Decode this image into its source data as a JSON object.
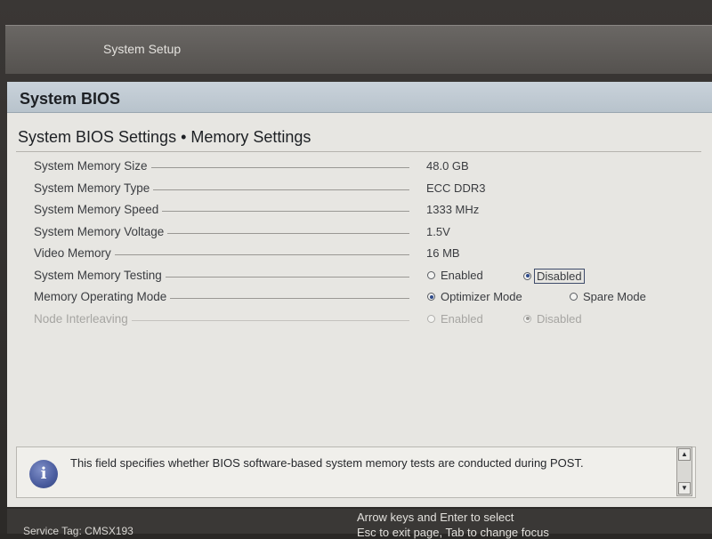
{
  "window": {
    "title": "System Setup"
  },
  "section": {
    "title": "System BIOS"
  },
  "subheader": "System BIOS Settings • Memory Settings",
  "settings": [
    {
      "label": "System Memory Size",
      "value": "48.0 GB"
    },
    {
      "label": "System Memory Type",
      "value": "ECC DDR3"
    },
    {
      "label": "System Memory Speed",
      "value": "1333 MHz"
    },
    {
      "label": "System Memory Voltage",
      "value": "1.5V"
    },
    {
      "label": "Video Memory",
      "value": "16 MB"
    },
    {
      "label": "System Memory Testing",
      "options": [
        "Enabled",
        "Disabled"
      ],
      "selected": "Disabled",
      "focused": "Disabled"
    },
    {
      "label": "Memory Operating Mode",
      "options": [
        "Optimizer Mode",
        "Spare Mode"
      ],
      "selected": "Optimizer Mode"
    },
    {
      "label": "Node Interleaving",
      "options": [
        "Enabled",
        "Disabled"
      ],
      "selected": "Disabled",
      "disabled": true
    }
  ],
  "help": {
    "icon": "info-icon",
    "text": "This field specifies whether BIOS software-based system memory tests are conducted during POST."
  },
  "footer": {
    "left": "Service Tag: CMSX193",
    "hint_line1": "Arrow keys and Enter to select",
    "hint_line2": "Esc to exit page, Tab to change focus"
  },
  "colors": {
    "header_band": "#c9d2da",
    "radio_selected": "#2d4a8a",
    "info_icon": "#4a5c9e"
  }
}
